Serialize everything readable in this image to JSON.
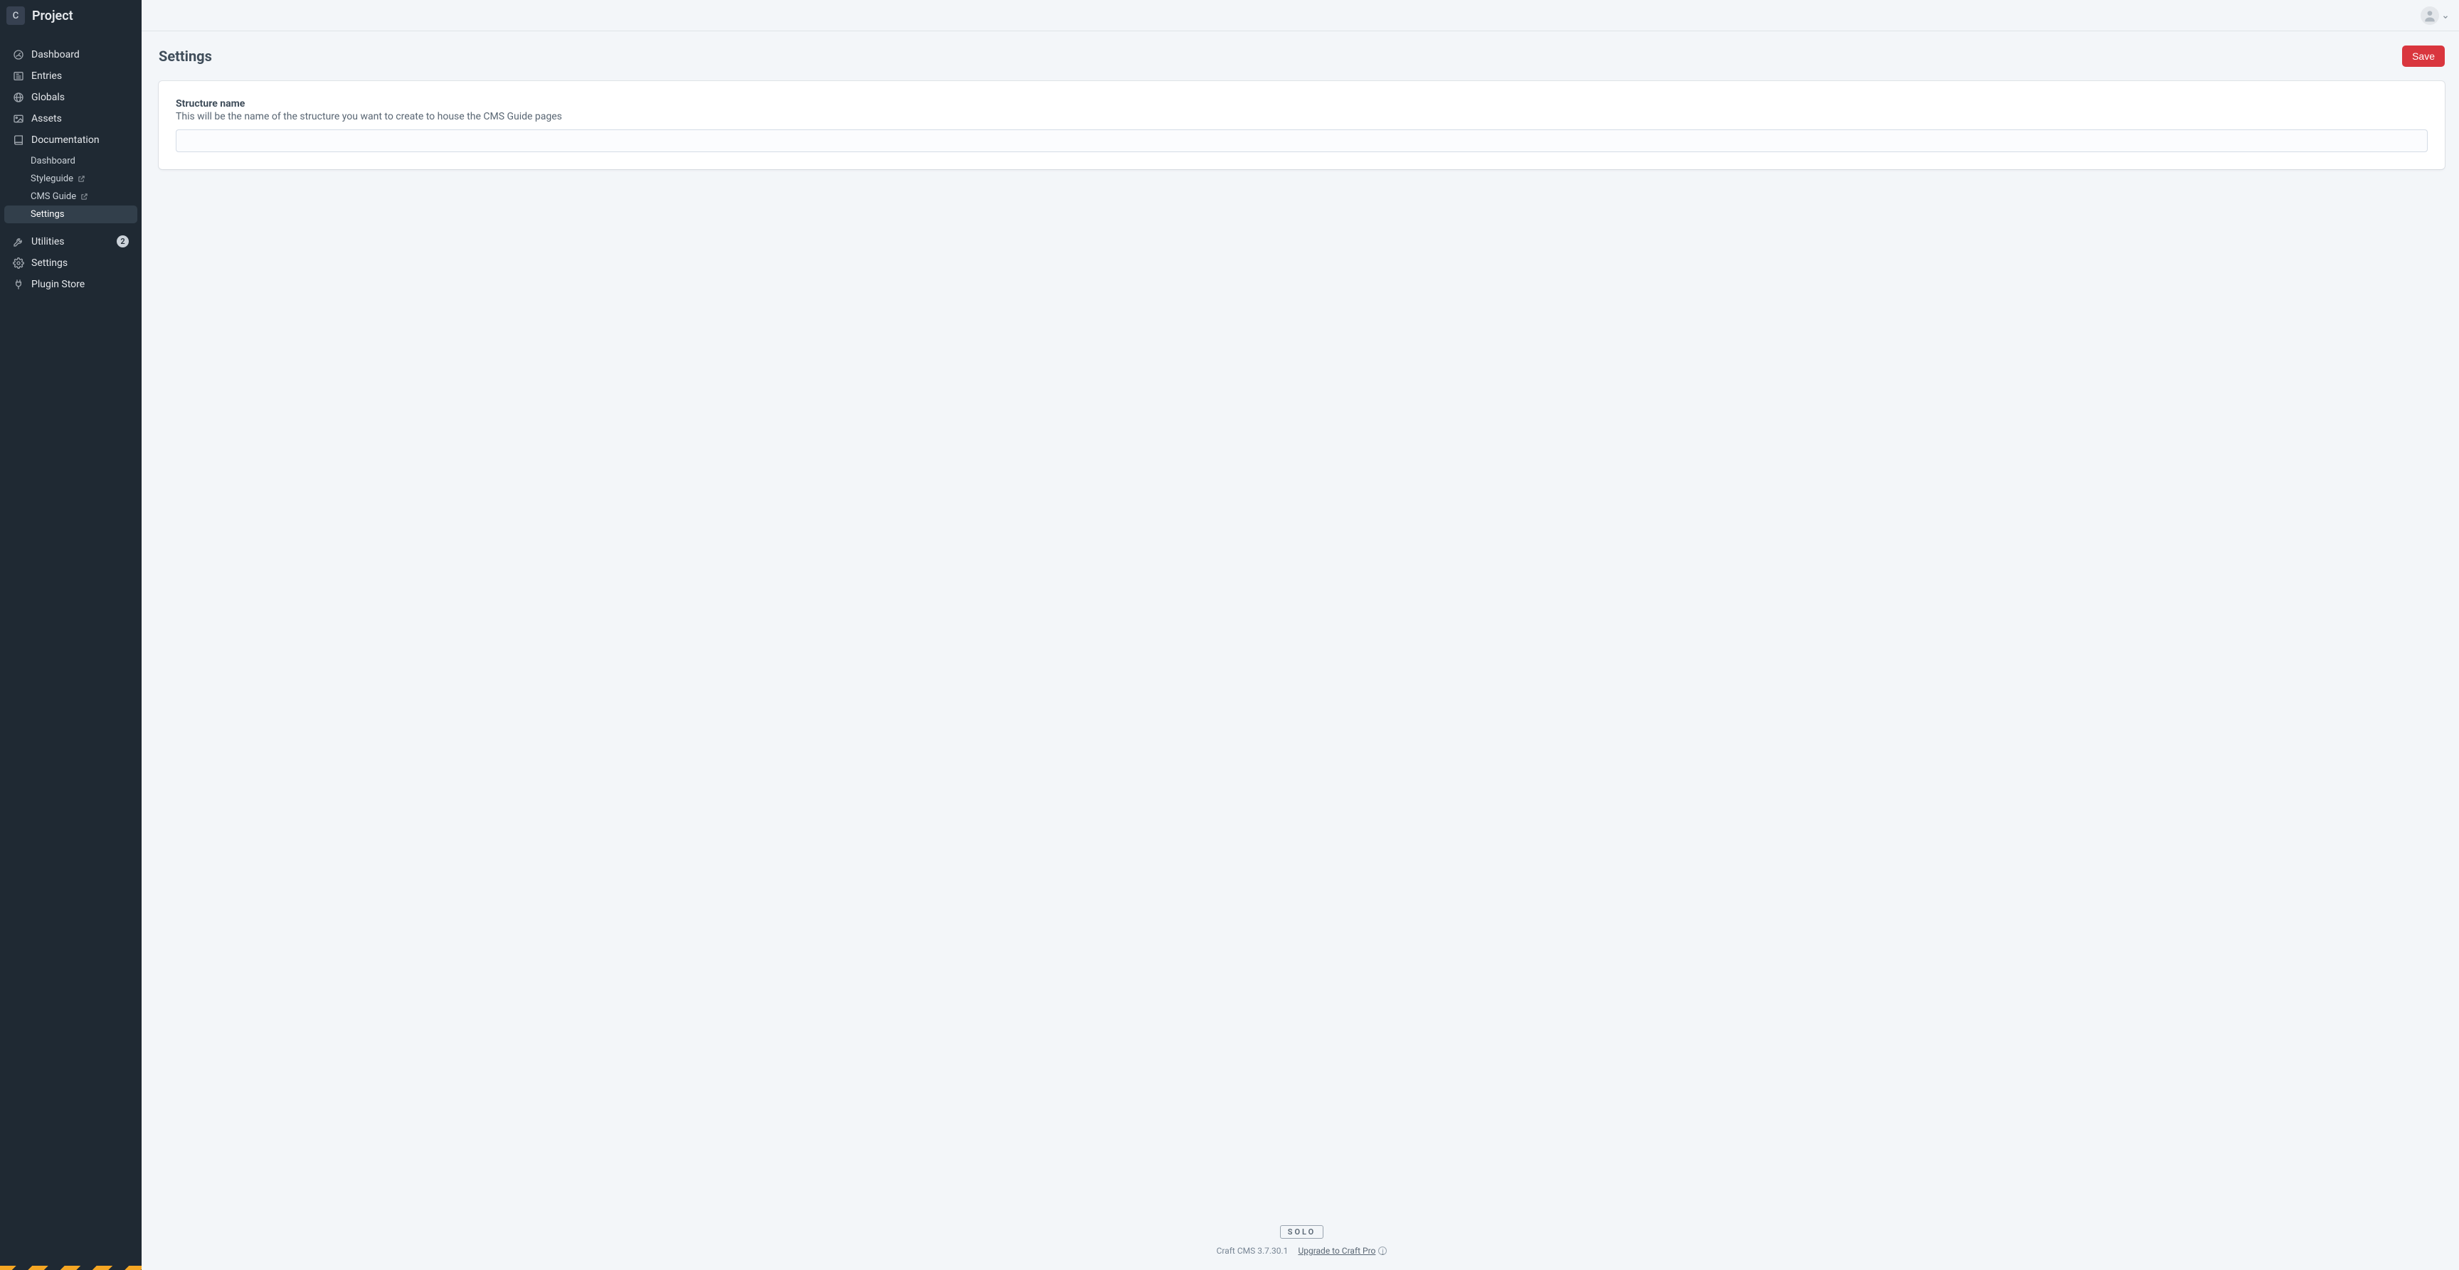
{
  "site": {
    "icon_letter": "C",
    "name": "Project"
  },
  "nav": {
    "dashboard": "Dashboard",
    "entries": "Entries",
    "globals": "Globals",
    "assets": "Assets",
    "documentation": "Documentation",
    "utilities": {
      "label": "Utilities",
      "badge": "2"
    },
    "settings": "Settings",
    "plugin_store": "Plugin Store"
  },
  "subnav": {
    "dashboard": "Dashboard",
    "styleguide": "Styleguide",
    "cms_guide": "CMS Guide",
    "settings": "Settings"
  },
  "page": {
    "title": "Settings",
    "save_label": "Save"
  },
  "field": {
    "heading": "Structure name",
    "instructions": "This will be the name of the structure you want to create to house the CMS Guide pages",
    "value": ""
  },
  "footer": {
    "edition": "SOLO",
    "version": "Craft CMS 3.7.30.1",
    "upgrade": "Upgrade to Craft Pro"
  }
}
